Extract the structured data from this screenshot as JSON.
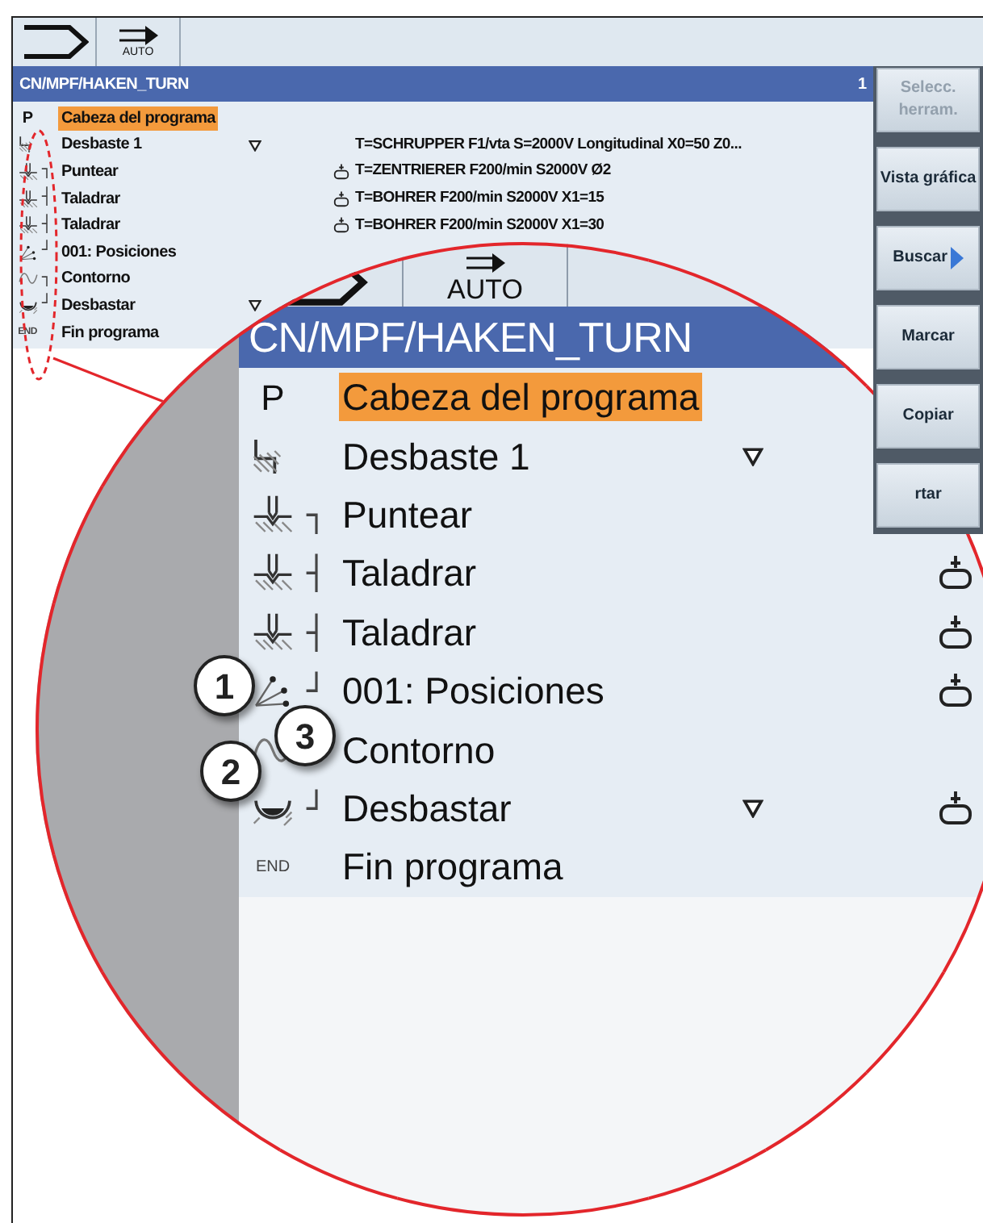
{
  "screen": {
    "tabs": [
      {
        "kind": "machine"
      },
      {
        "kind": "auto",
        "label": "AUTO"
      }
    ],
    "path": "CN/MPF/HAKEN_TURN",
    "channel": "1",
    "rows": [
      {
        "kind": "header",
        "marker": "P",
        "label": "Cabeza del programa",
        "selected": true,
        "expandable": false,
        "tool": false
      },
      {
        "kind": "roughing",
        "label": "Desbaste 1",
        "selected": false,
        "expandable": true,
        "tool": false,
        "detail": "T=SCHRUPPER F1/vta S=2000V Longitudinal X0=50 Z0..."
      },
      {
        "kind": "drilling",
        "bracket": "┐",
        "label": "Puntear",
        "selected": false,
        "expandable": false,
        "tool": true,
        "detail": "T=ZENTRIERER F200/min S2000V Ø2"
      },
      {
        "kind": "drilling",
        "bracket": "┤",
        "label": "Taladrar",
        "selected": false,
        "expandable": false,
        "tool": true,
        "detail": "T=BOHRER F200/min S2000V X1=15"
      },
      {
        "kind": "drilling",
        "bracket": "┤",
        "label": "Taladrar",
        "selected": false,
        "expandable": false,
        "tool": true,
        "detail": "T=BOHRER F200/min S2000V X1=30"
      },
      {
        "kind": "positions",
        "bracket": "┘",
        "label": "001: Posiciones",
        "selected": false,
        "expandable": false,
        "tool": false
      },
      {
        "kind": "contour",
        "bracket": "┐",
        "label": "Contorno",
        "selected": false,
        "expandable": false,
        "tool": false
      },
      {
        "kind": "stock_removal",
        "bracket": "┘",
        "label": "Desbastar",
        "selected": false,
        "expandable": true,
        "tool": false
      },
      {
        "kind": "end",
        "marker": "END",
        "label": "Fin programa",
        "selected": false,
        "expandable": false,
        "tool": false
      }
    ],
    "softkeys": [
      {
        "label": "Selecc. herram.",
        "disabled": true,
        "arrow": false
      },
      {
        "label": "Vista gráfica",
        "disabled": false,
        "arrow": false
      },
      {
        "label": "Buscar",
        "disabled": false,
        "arrow": true
      },
      {
        "label": "Marcar",
        "disabled": false,
        "arrow": false
      },
      {
        "label": "Copiar",
        "disabled": false,
        "arrow": false
      },
      {
        "label": "rtar",
        "disabled": false,
        "arrow": false
      }
    ]
  },
  "magnifier": {
    "tabs": [
      {
        "kind": "machine"
      },
      {
        "kind": "auto",
        "label": "AUTO"
      }
    ],
    "path": "CN/MPF/HAKEN_TURN",
    "rows": [
      {
        "kind": "header",
        "marker": "P",
        "label": "Cabeza del programa",
        "selected": true,
        "expandable": false,
        "tool": false
      },
      {
        "kind": "roughing",
        "label": "Desbaste 1",
        "selected": false,
        "expandable": true,
        "tool": false
      },
      {
        "kind": "drilling",
        "bracket": "┐",
        "label": "Puntear",
        "selected": false,
        "expandable": false,
        "tool": false
      },
      {
        "kind": "drilling",
        "bracket": "┤",
        "label": "Taladrar",
        "selected": false,
        "expandable": false,
        "tool": true
      },
      {
        "kind": "drilling",
        "bracket": "┤",
        "label": "Taladrar",
        "selected": false,
        "expandable": false,
        "tool": true
      },
      {
        "kind": "positions",
        "bracket": "┘",
        "label": "001: Posiciones",
        "selected": false,
        "expandable": false,
        "tool": true
      },
      {
        "kind": "contour",
        "label": "Contorno",
        "selected": false,
        "expandable": false,
        "tool": false
      },
      {
        "kind": "stock_removal",
        "bracket": "┘",
        "label": "Desbastar",
        "selected": false,
        "expandable": true,
        "tool": true
      },
      {
        "kind": "end",
        "marker": "END",
        "label": "Fin programa",
        "selected": false,
        "expandable": false,
        "tool": false
      }
    ]
  },
  "callouts": [
    "1",
    "2",
    "3"
  ]
}
